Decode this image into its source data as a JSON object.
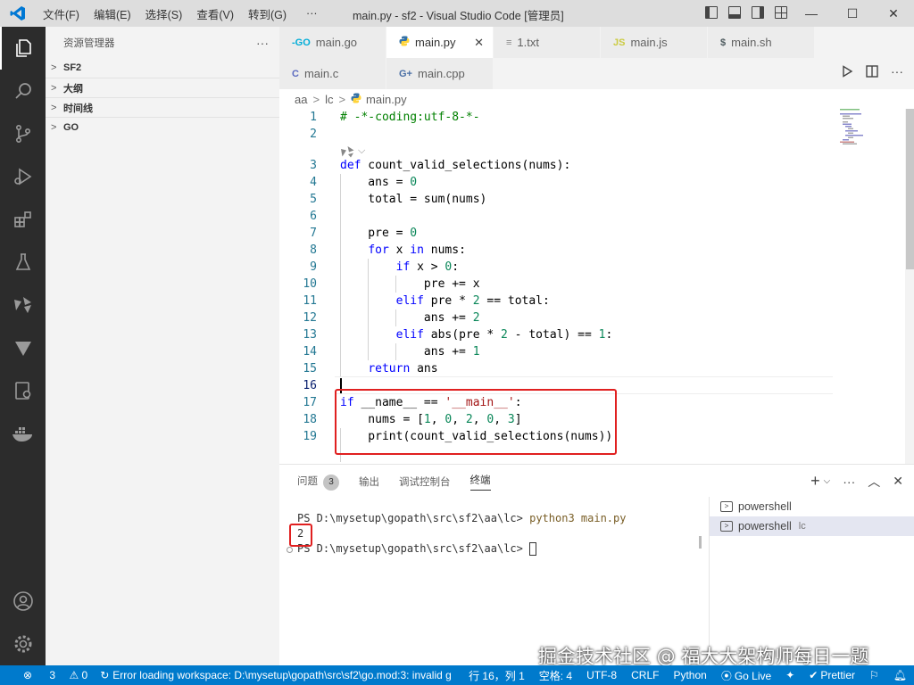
{
  "titlebar": {
    "menu": [
      "文件(F)",
      "编辑(E)",
      "选择(S)",
      "查看(V)",
      "转到(G)",
      "···"
    ],
    "title": "main.py - sf2 - Visual Studio Code [管理员]"
  },
  "sidebar": {
    "title": "资源管理器",
    "more": "···",
    "sections": [
      "SF2",
      "大纲",
      "时间线",
      "GO"
    ]
  },
  "tabs": [
    {
      "icon": "-GO",
      "label": "main.go",
      "active": false
    },
    {
      "icon": "py",
      "label": "main.py",
      "active": true
    },
    {
      "icon": "≡",
      "label": "1.txt",
      "active": false
    },
    {
      "icon": "JS",
      "label": "main.js",
      "active": false
    },
    {
      "icon": "$",
      "label": "main.sh",
      "active": false
    },
    {
      "icon": "C",
      "label": "main.c",
      "active": false
    },
    {
      "icon": "G+",
      "label": "main.cpp",
      "active": false
    }
  ],
  "breadcrumb": [
    "aa",
    "lc",
    "main.py"
  ],
  "editor": {
    "line_numbers": [
      "1",
      "2",
      "3",
      "4",
      "5",
      "6",
      "7",
      "8",
      "9",
      "10",
      "11",
      "12",
      "13",
      "14",
      "15",
      "16",
      "17",
      "18",
      "19"
    ]
  },
  "panel": {
    "tabs": [
      "问题",
      "输出",
      "调试控制台",
      "终端"
    ],
    "problems_count": "3",
    "terminal": {
      "line1_prompt": "PS D:\\mysetup\\gopath\\src\\sf2\\aa\\lc> ",
      "line1_cmd": "python3 main.py",
      "line2": "2",
      "line3_prompt": "PS D:\\mysetup\\gopath\\src\\sf2\\aa\\lc> "
    },
    "terminals": [
      {
        "label": "powershell",
        "suffix": "",
        "selected": false
      },
      {
        "label": "powershell",
        "suffix": "lc",
        "selected": true
      }
    ]
  },
  "statusbar": {
    "errors": "3",
    "warnings": "0",
    "message": "Error loading workspace: D:\\mysetup\\gopath\\src\\sf2\\go.mod:3: invalid g",
    "position": "行 16，列 1",
    "spaces": "空格: 4",
    "encoding": "UTF-8",
    "eol": "CRLF",
    "language": "Python",
    "golive": "Go Live",
    "prettier": "Prettier"
  },
  "watermark": "掘金技术社区 @ 福大大架构师每日一题"
}
